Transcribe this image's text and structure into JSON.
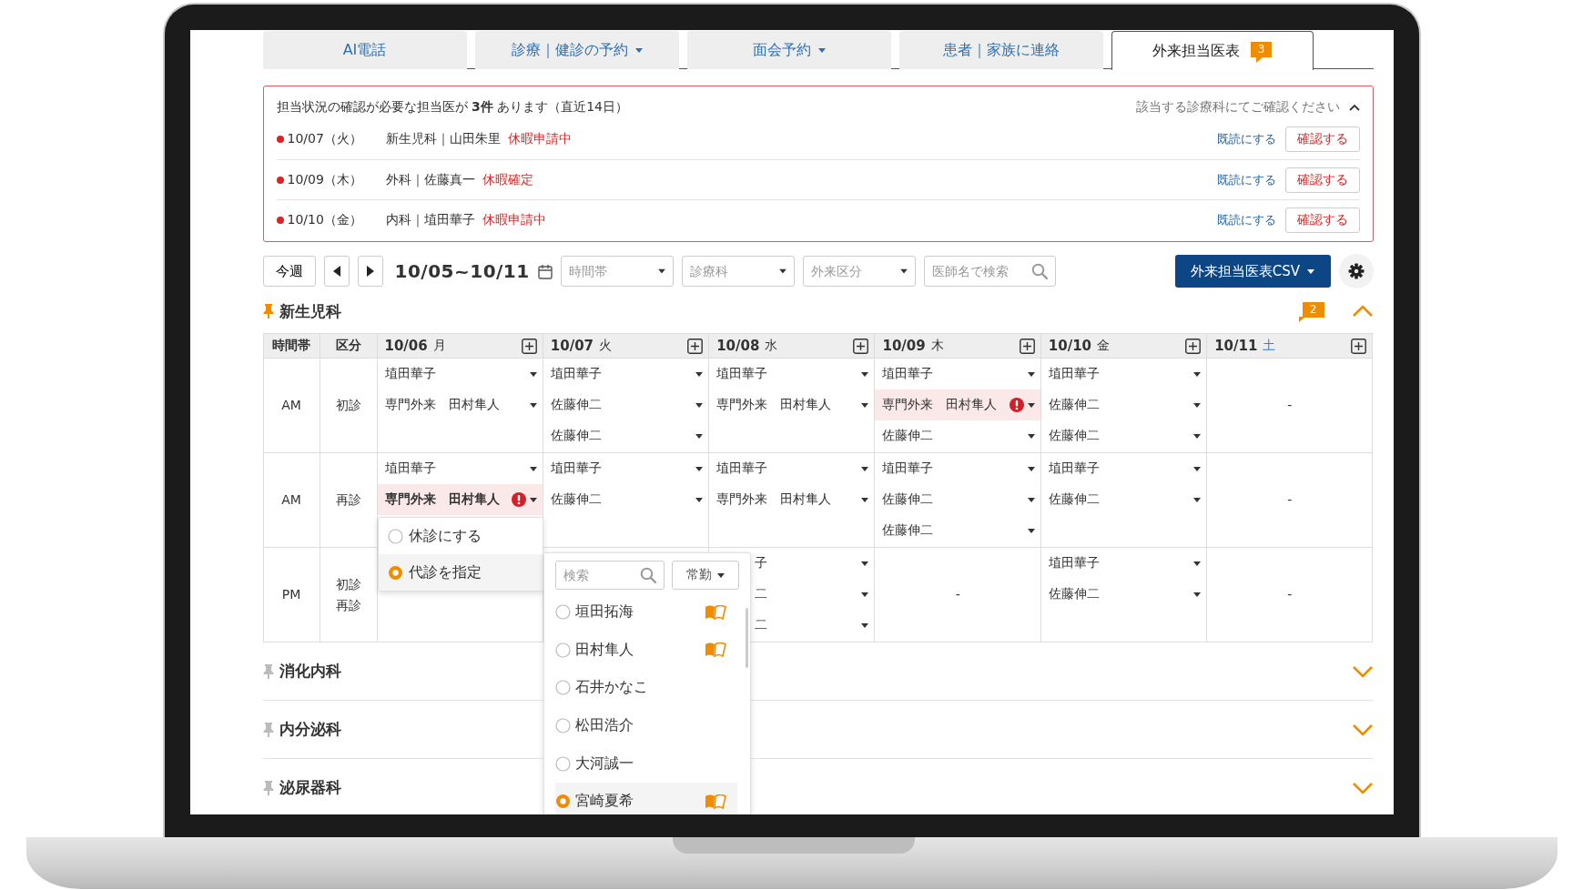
{
  "tabs": [
    {
      "label": "AI電話",
      "selected": false,
      "has_menu": false
    },
    {
      "label": "診療｜健診の予約",
      "selected": false,
      "has_menu": true
    },
    {
      "label": "面会予約",
      "selected": false,
      "has_menu": true
    },
    {
      "label": "患者｜家族に連絡",
      "selected": false,
      "has_menu": false
    },
    {
      "label": "外来担当医表",
      "selected": true,
      "has_menu": false,
      "badge": "3"
    }
  ],
  "alert": {
    "summary": "担当状況の確認が必要な担当医が **3件** あります（直近14日）",
    "hint": "該当する診療科にてご確認ください",
    "expanded": true,
    "items": [
      {
        "date": "10/07（火）",
        "assignment": "新生児科｜山田朱里",
        "status": "休暇申請中",
        "read_link": "既読にする",
        "confirm_button": "確認する"
      },
      {
        "date": "10/09（木）",
        "assignment": "外科｜佐藤真一",
        "status": "休暇確定",
        "read_link": "既読にする",
        "confirm_button": "確認する"
      },
      {
        "date": "10/10（金）",
        "assignment": "内科｜埴田華子",
        "status": "休暇申請中",
        "read_link": "既読にする",
        "confirm_button": "確認する"
      }
    ]
  },
  "toolbar": {
    "this_week_button": "今週",
    "range": "10/05~10/11",
    "filters": [
      {
        "kind": "select",
        "placeholder": "時間帯"
      },
      {
        "kind": "select",
        "placeholder": "診療科"
      },
      {
        "kind": "select",
        "placeholder": "外来区分"
      },
      {
        "kind": "search",
        "placeholder": "医師名で検索"
      }
    ],
    "csv_button": "外来担当医表CSV"
  },
  "departments": [
    {
      "name": "新生児科",
      "pinned": true,
      "expanded": true,
      "badge": "2",
      "table": {
        "columns": [
          "時間帯",
          "区分"
        ],
        "days": [
          {
            "date": "10/06",
            "weekday": "月",
            "kind": "weekday"
          },
          {
            "date": "10/07",
            "weekday": "火",
            "kind": "weekday"
          },
          {
            "date": "10/08",
            "weekday": "水",
            "kind": "weekday"
          },
          {
            "date": "10/09",
            "weekday": "木",
            "kind": "weekday"
          },
          {
            "date": "10/10",
            "weekday": "金",
            "kind": "weekday"
          },
          {
            "date": "10/11",
            "weekday": "土",
            "kind": "saturday"
          }
        ],
        "rows": [
          {
            "time": "AM",
            "type": "初診",
            "cells": [
              {
                "kind": "entries",
                "entries": [
                  {
                    "text": "埴田華子",
                    "warning": false,
                    "open": false
                  },
                  {
                    "text": "専門外来　田村隼人",
                    "warning": false,
                    "open": false
                  }
                ]
              },
              {
                "kind": "entries",
                "entries": [
                  {
                    "text": "埴田華子",
                    "warning": false,
                    "open": false
                  },
                  {
                    "text": "佐藤伸二",
                    "warning": false,
                    "open": false
                  },
                  {
                    "text": "佐藤伸二",
                    "warning": false,
                    "open": false
                  }
                ]
              },
              {
                "kind": "entries",
                "entries": [
                  {
                    "text": "埴田華子",
                    "warning": false,
                    "open": false
                  },
                  {
                    "text": "専門外来　田村隼人",
                    "warning": false,
                    "open": false
                  }
                ]
              },
              {
                "kind": "entries",
                "entries": [
                  {
                    "text": "埴田華子",
                    "warning": false,
                    "open": false
                  },
                  {
                    "text": "専門外来　田村隼人",
                    "warning": true,
                    "open": false
                  },
                  {
                    "text": "佐藤伸二",
                    "warning": false,
                    "open": false
                  }
                ]
              },
              {
                "kind": "entries",
                "entries": [
                  {
                    "text": "埴田華子",
                    "warning": false,
                    "open": false
                  },
                  {
                    "text": "佐藤伸二",
                    "warning": false,
                    "open": false
                  },
                  {
                    "text": "佐藤伸二",
                    "warning": false,
                    "open": false
                  }
                ]
              },
              {
                "kind": "dash",
                "dash": "-"
              }
            ]
          },
          {
            "time": "AM",
            "type": "再診",
            "cells": [
              {
                "kind": "entries",
                "entries": [
                  {
                    "text": "埴田華子",
                    "warning": false,
                    "open": false
                  },
                  {
                    "text": "専門外来　田村隼人",
                    "warning": true,
                    "open": true
                  }
                ]
              },
              {
                "kind": "entries",
                "entries": [
                  {
                    "text": "埴田華子",
                    "warning": false,
                    "open": false
                  },
                  {
                    "text": "佐藤伸二",
                    "warning": false,
                    "open": false
                  }
                ]
              },
              {
                "kind": "entries",
                "entries": [
                  {
                    "text": "埴田華子",
                    "warning": false,
                    "open": false
                  },
                  {
                    "text": "専門外来　田村隼人",
                    "warning": false,
                    "open": false
                  }
                ]
              },
              {
                "kind": "entries",
                "entries": [
                  {
                    "text": "埴田華子",
                    "warning": false,
                    "open": false
                  },
                  {
                    "text": "佐藤伸二",
                    "warning": false,
                    "open": false
                  },
                  {
                    "text": "佐藤伸二",
                    "warning": false,
                    "open": false
                  }
                ]
              },
              {
                "kind": "entries",
                "entries": [
                  {
                    "text": "埴田華子",
                    "warning": false,
                    "open": false
                  },
                  {
                    "text": "佐藤伸二",
                    "warning": false,
                    "open": false
                  }
                ]
              },
              {
                "kind": "dash",
                "dash": "-"
              }
            ]
          },
          {
            "time": "PM",
            "type": "初診再診",
            "cells": [
              {
                "kind": "blank"
              },
              {
                "kind": "blank"
              },
              {
                "kind": "partial",
                "entries": [
                  {
                    "text": "子",
                    "warning": false,
                    "open": false
                  },
                  {
                    "text": "二",
                    "warning": false,
                    "open": false
                  },
                  {
                    "text": "二",
                    "warning": false,
                    "open": false
                  }
                ]
              },
              {
                "kind": "dash",
                "dash": "-"
              },
              {
                "kind": "entries",
                "entries": [
                  {
                    "text": "埴田華子",
                    "warning": false,
                    "open": false
                  },
                  {
                    "text": "佐藤伸二",
                    "warning": false,
                    "open": false
                  }
                ]
              },
              {
                "kind": "dash",
                "dash": "-"
              }
            ]
          }
        ]
      }
    },
    {
      "name": "消化内科",
      "pinned": false,
      "expanded": false
    },
    {
      "name": "内分泌科",
      "pinned": false,
      "expanded": false
    },
    {
      "name": "泌尿器科",
      "pinned": false,
      "expanded": false
    }
  ],
  "absence_menu": {
    "options": [
      {
        "label": "休診にする",
        "selected": false
      },
      {
        "label": "代診を指定",
        "selected": true
      }
    ]
  },
  "substitute_menu": {
    "search_placeholder": "検索",
    "filter_button": "常勤",
    "doctors": [
      {
        "name": "垣田拓海",
        "selected": false,
        "book": true
      },
      {
        "name": "田村隼人",
        "selected": false,
        "book": true
      },
      {
        "name": "石井かなこ",
        "selected": false,
        "book": false
      },
      {
        "name": "松田浩介",
        "selected": false,
        "book": false
      },
      {
        "name": "大河誠一",
        "selected": false,
        "book": false
      },
      {
        "name": "宮崎夏希",
        "selected": true,
        "book": true
      }
    ]
  }
}
